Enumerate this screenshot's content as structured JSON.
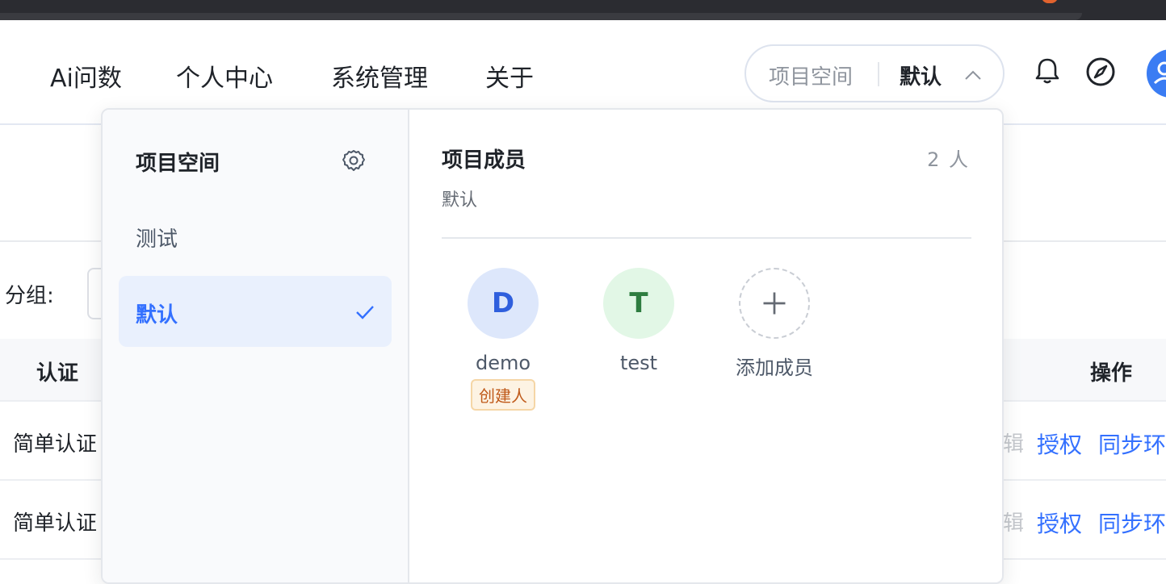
{
  "nav": {
    "items": [
      "Ai问数",
      "个人中心",
      "系统管理",
      "关于"
    ]
  },
  "space_switch": {
    "label": "项目空间",
    "value": "默认"
  },
  "background": {
    "group_label": "分组:",
    "table": {
      "headers": [
        "认证",
        "操作"
      ],
      "rows": [
        {
          "auth": "简单认证",
          "edit": "辑",
          "authorize": "授权",
          "sync": "同步环"
        },
        {
          "auth": "简单认证",
          "edit": "辑",
          "authorize": "授权",
          "sync": "同步环"
        }
      ]
    }
  },
  "dropdown": {
    "spaces_title": "项目空间",
    "spaces": [
      {
        "name": "测试",
        "active": false
      },
      {
        "name": "默认",
        "active": true
      }
    ],
    "members_title": "项目成员",
    "members_count": "2 人",
    "current_space": "默认",
    "members": [
      {
        "initial": "D",
        "name": "demo",
        "tag": "创建人"
      },
      {
        "initial": "T",
        "name": "test",
        "tag": ""
      }
    ],
    "add_member_label": "添加成员"
  },
  "colors": {
    "accent": "#3370ff",
    "active_bg": "#e9f0fd",
    "creator_tag": "#c05a1a"
  }
}
